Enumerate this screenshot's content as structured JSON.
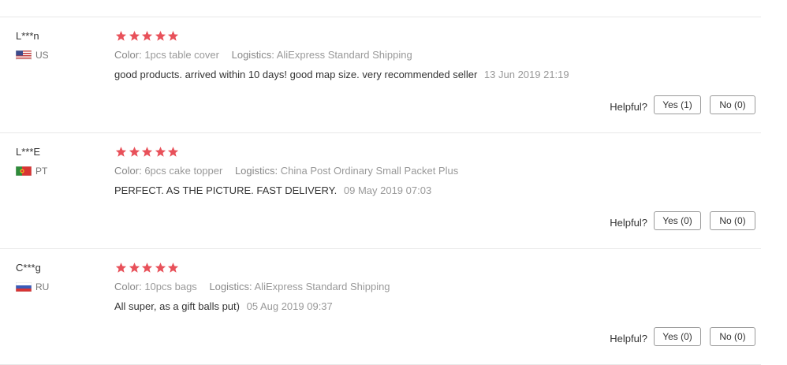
{
  "colors": {
    "star": "#e8515a",
    "divider": "#e8e8e8",
    "text_primary": "#333333",
    "text_muted": "#999999"
  },
  "reviews": [
    {
      "user": "L***n",
      "country_code": "US",
      "flag_icon": "us-flag-icon",
      "rating": 5,
      "color_label": "Color:",
      "color_value": "1pcs table cover",
      "logistics_label": "Logistics:",
      "logistics_value": "AliExpress Standard Shipping",
      "text": "good products. arrived within 10 days! good map size. very recommended seller",
      "date": "13 Jun 2019 21:19",
      "helpful_label": "Helpful?",
      "yes_label": "Yes (1)",
      "no_label": "No (0)"
    },
    {
      "user": "L***E",
      "country_code": "PT",
      "flag_icon": "pt-flag-icon",
      "rating": 5,
      "color_label": "Color:",
      "color_value": "6pcs cake topper",
      "logistics_label": "Logistics:",
      "logistics_value": "China Post Ordinary Small Packet Plus",
      "text": "PERFECT. AS THE PICTURE. FAST DELIVERY.",
      "date": "09 May 2019 07:03",
      "helpful_label": "Helpful?",
      "yes_label": "Yes (0)",
      "no_label": "No (0)"
    },
    {
      "user": "C***g",
      "country_code": "RU",
      "flag_icon": "ru-flag-icon",
      "rating": 5,
      "color_label": "Color:",
      "color_value": "10pcs bags",
      "logistics_label": "Logistics:",
      "logistics_value": "AliExpress Standard Shipping",
      "text": "All super, as a gift balls put)",
      "date": "05 Aug 2019 09:37",
      "helpful_label": "Helpful?",
      "yes_label": "Yes (0)",
      "no_label": "No (0)"
    }
  ]
}
